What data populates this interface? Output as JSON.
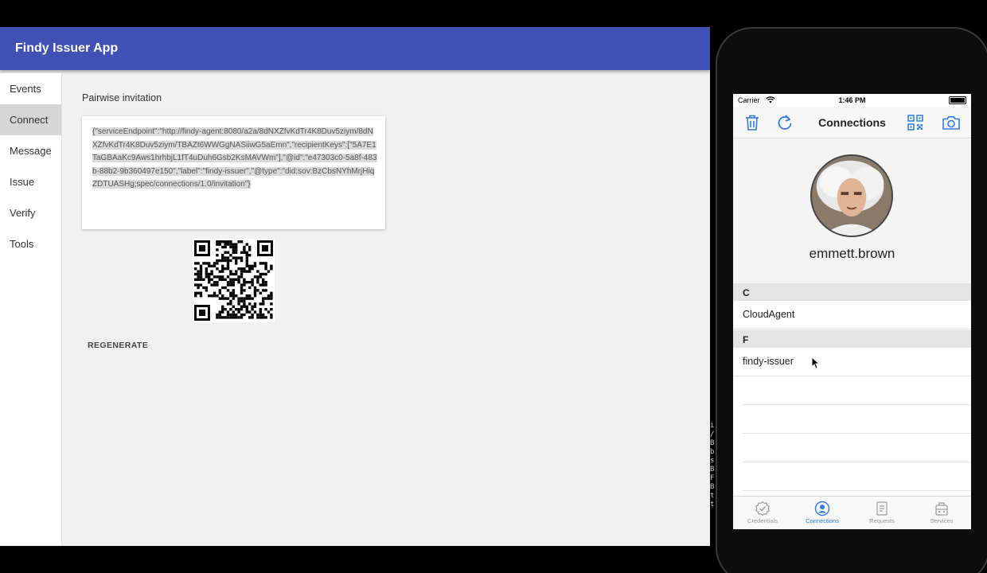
{
  "web": {
    "title": "Findy Issuer App",
    "nav": [
      {
        "label": "Events",
        "active": false
      },
      {
        "label": "Connect",
        "active": true
      },
      {
        "label": "Message",
        "active": false
      },
      {
        "label": "Issue",
        "active": false
      },
      {
        "label": "Verify",
        "active": false
      },
      {
        "label": "Tools",
        "active": false
      }
    ],
    "section_label": "Pairwise invitation",
    "invitation_json": "{\"serviceEndpoint\":\"http://findy-agent:8080/a2a/8dNXZfvKdTr4K8Duv5ziym/8dNXZfvKdTr4K8Duv5ziym/TBAZt6WWGgNASiiwG5aEmn\",\"recipientKeys\":[\"5A7E1TaGBAaKc9Aws1hrhbjL1fT4uDuh6Gsb2KsMAVWm\"],\"@id\":\"e47303c0-5a8f-483b-88b2-9b360497e150\",\"label\":\"findy-issuer\",\"@type\":\"did:sov:BzCbsNYhMrjHiqZDTUASHg;spec/connections/1.0/invitation\"}",
    "qr_code": "qr-code",
    "regenerate_label": "REGENERATE"
  },
  "terminal": {
    "chars": [
      "i",
      "/",
      "B",
      "b",
      "s",
      "B",
      "F",
      "B",
      "t",
      "t"
    ]
  },
  "phone": {
    "status": {
      "carrier": "Carrier",
      "time": "1:46 PM"
    },
    "nav_title": "Connections",
    "icons": {
      "left": [
        "trash-icon",
        "refresh-icon"
      ],
      "right": [
        "qr-code-icon",
        "camera-icon"
      ]
    },
    "accent_color": "#2f7de1",
    "username": "emmett.brown",
    "sections": [
      {
        "header": "C",
        "items": [
          "CloudAgent"
        ]
      },
      {
        "header": "F",
        "items": [
          "findy-issuer"
        ]
      }
    ],
    "tabs": [
      {
        "label": "Credentials",
        "active": false,
        "icon": "credentials-icon"
      },
      {
        "label": "Connections",
        "active": true,
        "icon": "connections-icon"
      },
      {
        "label": "Requests",
        "active": false,
        "icon": "requests-icon"
      },
      {
        "label": "Services",
        "active": false,
        "icon": "services-icon"
      }
    ]
  }
}
